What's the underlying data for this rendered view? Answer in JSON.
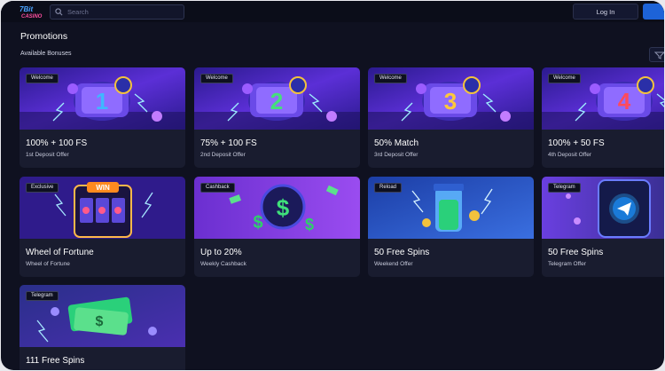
{
  "header": {
    "logo_text": "7Bit Casino",
    "search_placeholder": "Search",
    "login_label": "Log In"
  },
  "page": {
    "title": "Promotions",
    "section": "Available Bonuses"
  },
  "promotions": [
    {
      "badge": "Welcome",
      "title": "100% + 100 FS",
      "subtitle": "1st Deposit Offer",
      "art": "slot-reel-1"
    },
    {
      "badge": "Welcome",
      "title": "75% + 100 FS",
      "subtitle": "2nd Deposit Offer",
      "art": "slot-reel-2"
    },
    {
      "badge": "Welcome",
      "title": "50% Match",
      "subtitle": "3rd Deposit Offer",
      "art": "slot-reel-3"
    },
    {
      "badge": "Welcome",
      "title": "100% + 50 FS",
      "subtitle": "4th Deposit Offer",
      "art": "slot-reel-4"
    },
    {
      "badge": "Exclusive",
      "title": "Wheel of Fortune",
      "subtitle": "Wheel of Fortune",
      "art": "slot-machine-win"
    },
    {
      "badge": "Cashback",
      "title": "Up to 20%",
      "subtitle": "Weekly Cashback",
      "art": "dollar-coin"
    },
    {
      "badge": "Reload",
      "title": "50 Free Spins",
      "subtitle": "Weekend Offer",
      "art": "coin-jar"
    },
    {
      "badge": "Telegram",
      "title": "50 Free Spins",
      "subtitle": "Telegram Offer",
      "art": "telegram-phone"
    },
    {
      "badge": "Telegram",
      "title": "111 Free Spins",
      "subtitle": "",
      "art": "money-pile"
    }
  ],
  "colors": {
    "background": "#0f1120",
    "card": "#191c2f",
    "accent": "#1d63d8",
    "banner_welcome": "#5b2fd6",
    "banner_cashback": "#7b3ce0",
    "banner_reload": "#2a56c8"
  }
}
